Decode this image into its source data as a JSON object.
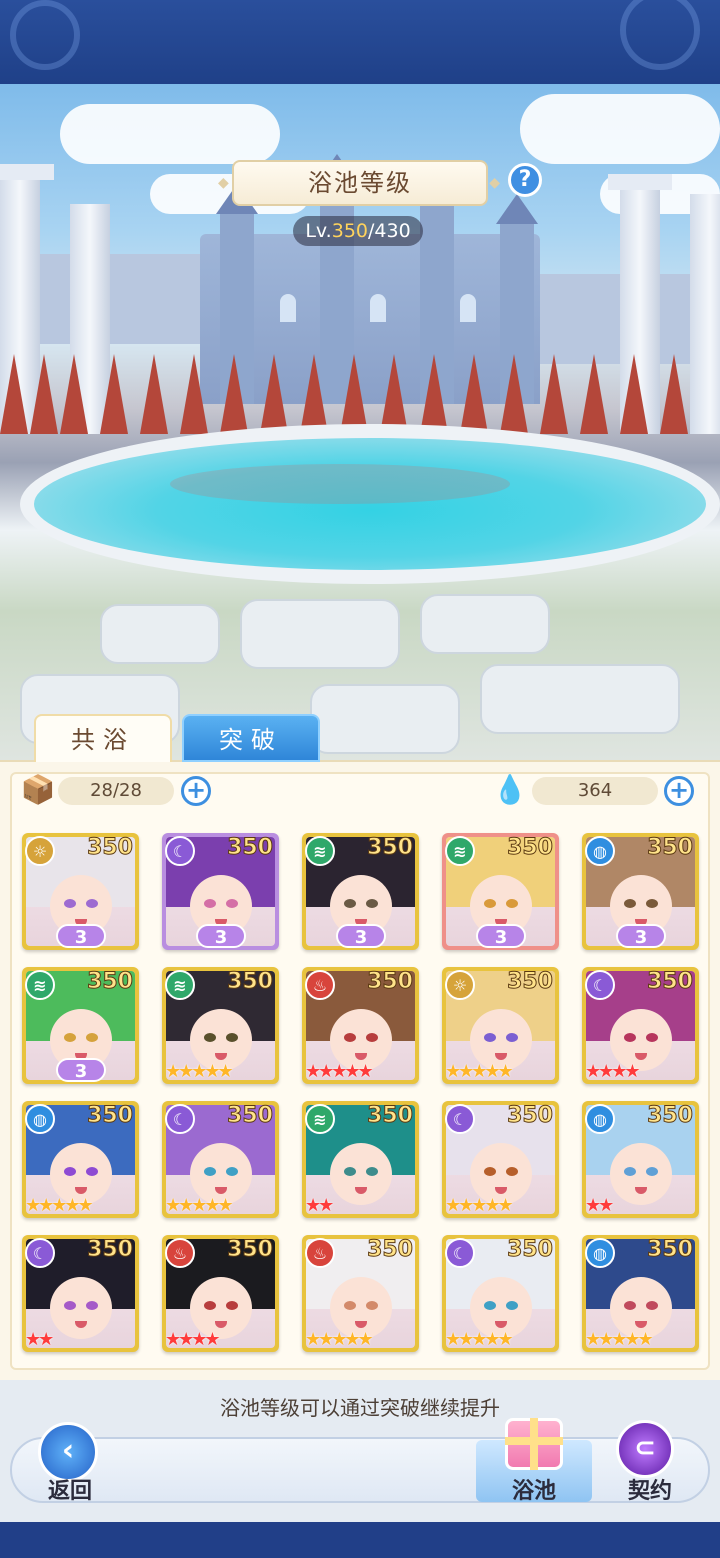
{
  "header": {
    "title": "浴池等级",
    "help_glyph": "?",
    "level_prefix": "Lv.",
    "level_current": "350",
    "level_separator": "/",
    "level_max": "430"
  },
  "tabs": [
    {
      "label": "共浴",
      "active": true
    },
    {
      "label": "突破",
      "active": false
    }
  ],
  "resources": {
    "slots": {
      "value": "28/28",
      "icon": "gift-box-icon"
    },
    "currency": {
      "value": "364",
      "icon": "water-spirit-icon"
    }
  },
  "cards": [
    {
      "level": "350",
      "element": "sun",
      "frame": "gold",
      "rank_type": "wings",
      "rank_value": "3"
    },
    {
      "level": "350",
      "element": "moon",
      "frame": "purple",
      "rank_type": "wings",
      "rank_value": "3"
    },
    {
      "level": "350",
      "element": "wind",
      "frame": "gold",
      "rank_type": "wings",
      "rank_value": "3"
    },
    {
      "level": "350",
      "element": "wind",
      "frame": "red",
      "rank_type": "wings",
      "rank_value": "3"
    },
    {
      "level": "350",
      "element": "water",
      "frame": "gold",
      "rank_type": "wings",
      "rank_value": "3"
    },
    {
      "level": "350",
      "element": "wind",
      "frame": "gold",
      "rank_type": "wings",
      "rank_value": "3"
    },
    {
      "level": "350",
      "element": "wind",
      "frame": "gold",
      "rank_type": "stars",
      "stars": 5,
      "star_color": "gold"
    },
    {
      "level": "350",
      "element": "fire",
      "frame": "gold",
      "rank_type": "stars",
      "stars": 5,
      "star_color": "red"
    },
    {
      "level": "350",
      "element": "sun",
      "frame": "gold",
      "rank_type": "stars",
      "stars": 5,
      "star_color": "gold"
    },
    {
      "level": "350",
      "element": "moon",
      "frame": "gold",
      "rank_type": "stars",
      "stars": 4,
      "star_color": "red"
    },
    {
      "level": "350",
      "element": "water",
      "frame": "gold",
      "rank_type": "stars",
      "stars": 5,
      "star_color": "gold"
    },
    {
      "level": "350",
      "element": "moon",
      "frame": "gold",
      "rank_type": "stars",
      "stars": 5,
      "star_color": "gold"
    },
    {
      "level": "350",
      "element": "wind",
      "frame": "gold",
      "rank_type": "stars",
      "stars": 2,
      "star_color": "red"
    },
    {
      "level": "350",
      "element": "moon",
      "frame": "gold",
      "rank_type": "stars",
      "stars": 5,
      "star_color": "gold"
    },
    {
      "level": "350",
      "element": "water",
      "frame": "gold",
      "rank_type": "stars",
      "stars": 2,
      "star_color": "red"
    },
    {
      "level": "350",
      "element": "moon",
      "frame": "gold",
      "rank_type": "stars",
      "stars": 2,
      "star_color": "red"
    },
    {
      "level": "350",
      "element": "fire",
      "frame": "gold",
      "rank_type": "stars",
      "stars": 4,
      "star_color": "red"
    },
    {
      "level": "350",
      "element": "fire",
      "frame": "gold",
      "rank_type": "stars",
      "stars": 5,
      "star_color": "gold"
    },
    {
      "level": "350",
      "element": "moon",
      "frame": "gold",
      "rank_type": "stars",
      "stars": 5,
      "star_color": "gold"
    },
    {
      "level": "350",
      "element": "water",
      "frame": "gold",
      "rank_type": "stars",
      "stars": 5,
      "star_color": "gold"
    }
  ],
  "element_colors": {
    "sun": "#d6a33a",
    "moon": "#8a5ad6",
    "wind": "#2fa86a",
    "fire": "#d8443c",
    "water": "#2f8ee0"
  },
  "element_glyphs": {
    "sun": "☼",
    "moon": "☾",
    "wind": "≋",
    "fire": "♨",
    "water": "◍"
  },
  "hint": "浴池等级可以通过突破继续提升",
  "nav": {
    "back_label": "返回",
    "bath_label": "浴池",
    "contract_label": "契约"
  }
}
